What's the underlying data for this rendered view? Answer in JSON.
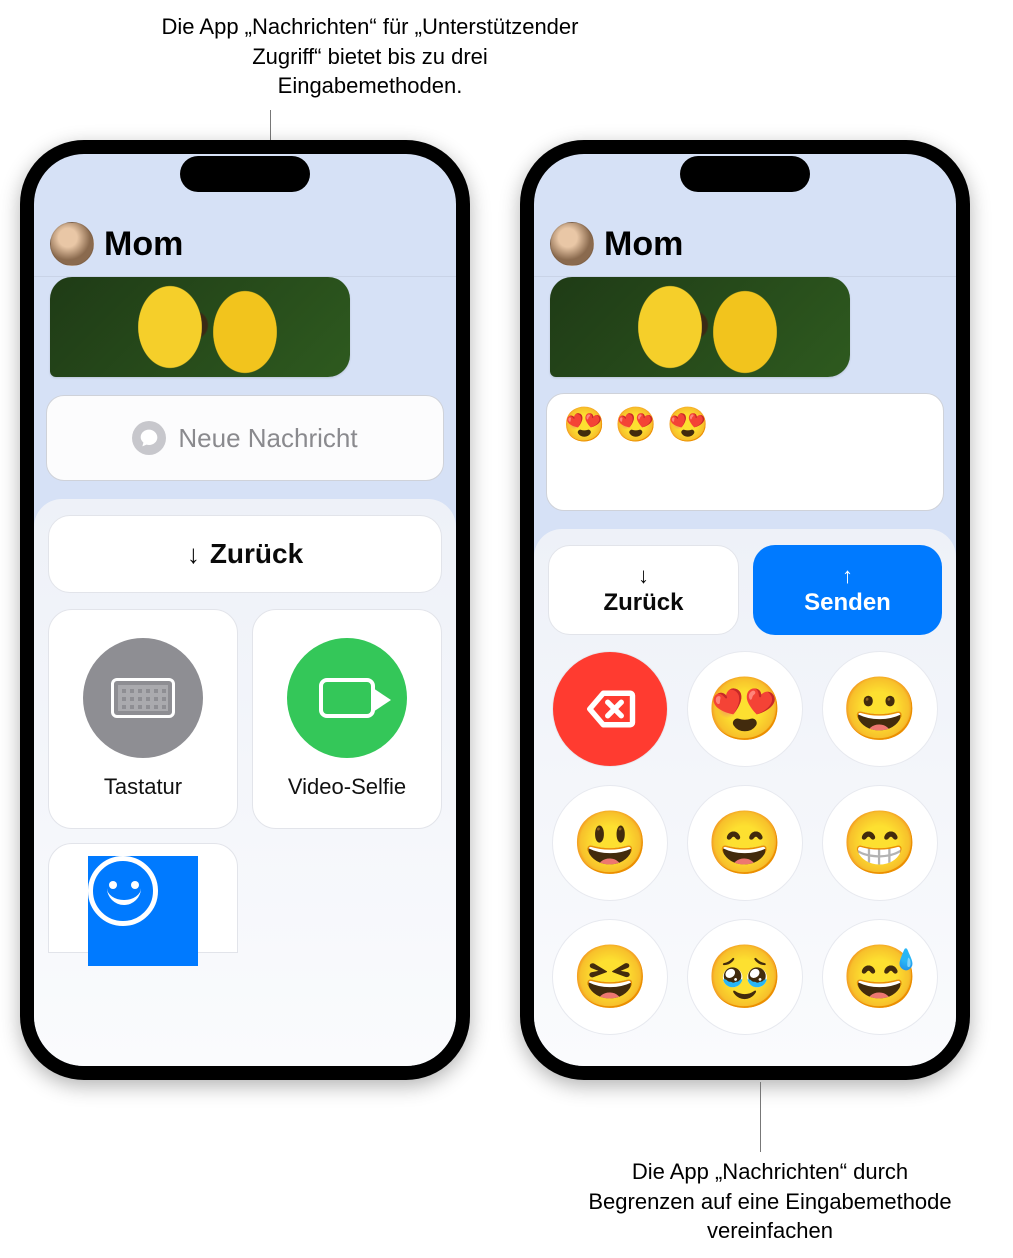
{
  "captions": {
    "top": "Die App „Nachrichten“ für „Unterstützender Zugriff“ bietet bis zu drei Eingabemethoden.",
    "bottom": "Die App „Nachrichten“ durch Begrenzen auf eine Eingabemethode vereinfachen"
  },
  "contact_name": "Mom",
  "phone1": {
    "compose_placeholder": "Neue Nachricht",
    "back_label": "Zurück",
    "tiles": {
      "keyboard": "Tastatur",
      "video": "Video-Selfie"
    }
  },
  "phone2": {
    "compose_value": "😍 😍 😍",
    "back_label": "Zurück",
    "send_label": "Senden",
    "emoji_keys": [
      "😍",
      "😀",
      "😃",
      "😄",
      "😁",
      "😆",
      "🥹",
      "😅"
    ]
  }
}
